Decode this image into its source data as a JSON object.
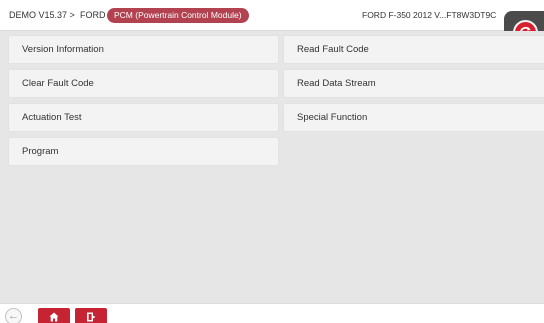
{
  "header": {
    "breadcrumb_demo": "DEMO V15.37 >",
    "breadcrumb_ford": "FORD >",
    "breadcrumb_module": "PCM (Powertrain Control Module)",
    "vehicle_info": "FORD  F-350  2012  V...FT8W3DT9C"
  },
  "menu": {
    "left": [
      {
        "label": "Version Information"
      },
      {
        "label": "Clear Fault Code"
      },
      {
        "label": "Actuation Test"
      },
      {
        "label": "Program"
      }
    ],
    "right": [
      {
        "label": "Read Fault Code"
      },
      {
        "label": "Read Data Stream"
      },
      {
        "label": "Special Function"
      }
    ]
  },
  "footer": {
    "icons": [
      "back-arrow-icon",
      "home-icon",
      "exit-icon"
    ]
  },
  "colors": {
    "accent": "#c62333",
    "pill": "#b34250",
    "background": "#e6e6e6"
  }
}
